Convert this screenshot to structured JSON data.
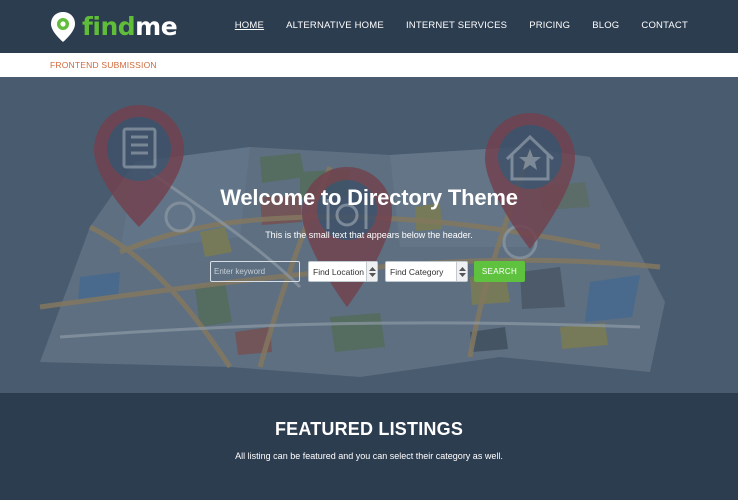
{
  "brand": {
    "name_part1": "find",
    "name_part2": "me",
    "logo_icon": "map-pin-icon"
  },
  "nav": {
    "items": [
      {
        "label": "HOME",
        "active": true
      },
      {
        "label": "ALTERNATIVE HOME"
      },
      {
        "label": "INTERNET SERVICES"
      },
      {
        "label": "PRICING"
      },
      {
        "label": "BLOG"
      },
      {
        "label": "CONTACT"
      }
    ]
  },
  "subbar": {
    "link": "FRONTEND SUBMISSION"
  },
  "hero": {
    "title": "Welcome to Directory Theme",
    "subtitle": "This is the small text that appears below the header.",
    "pins": [
      "hotel-icon",
      "restaurant-icon",
      "home-star-icon"
    ]
  },
  "search": {
    "keyword_placeholder": "Enter keyword",
    "location_selected": "Find Location",
    "category_selected": "Find Category",
    "button_label": "SEARCH"
  },
  "featured": {
    "title": "FEATURED LISTINGS",
    "subtitle": "All listing can be featured and you can select their category as well."
  },
  "colors": {
    "header_bg": "#2d3d50",
    "accent_green": "#5ec23f",
    "accent_orange": "#d0683a",
    "pin_red": "#9e3940"
  }
}
